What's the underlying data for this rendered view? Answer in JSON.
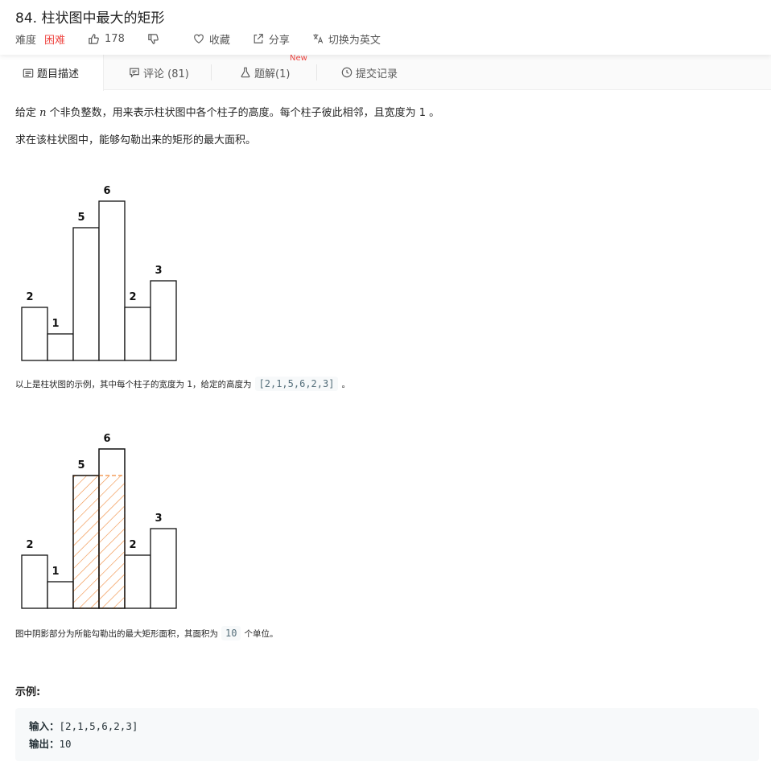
{
  "problem": {
    "title": "84. 柱状图中最大的矩形",
    "difficulty_label": "难度",
    "difficulty": "困难",
    "likes": "178",
    "favorite_label": "收藏",
    "share_label": "分享",
    "switch_label": "切换为英文"
  },
  "tabs": [
    {
      "label": "题目描述"
    },
    {
      "label": "评论 (81)"
    },
    {
      "label": "题解(1)",
      "badge": "New"
    },
    {
      "label": "提交记录"
    }
  ],
  "description": {
    "p1_before": "给定 ",
    "p1_var": "n",
    "p1_after": " 个非负整数，用来表示柱状图中各个柱子的高度。每个柱子彼此相邻，且宽度为 1 。",
    "p2": "求在该柱状图中，能够勾勒出来的矩形的最大面积。",
    "caption1_before": "以上是柱状图的示例，其中每个柱子的宽度为 1，给定的高度为",
    "caption1_code": "[2,1,5,6,2,3]",
    "caption1_after": "。",
    "caption2_before": "图中阴影部分为所能勾勒出的最大矩形面积，其面积为",
    "caption2_code": "10",
    "caption2_after": "个单位。"
  },
  "chart_data": [
    {
      "type": "bar",
      "values": [
        2,
        1,
        5,
        6,
        2,
        3
      ],
      "data_labels": [
        "2",
        "1",
        "5",
        "6",
        "2",
        "3"
      ]
    },
    {
      "type": "bar",
      "values": [
        2,
        1,
        5,
        6,
        2,
        3
      ],
      "data_labels": [
        "2",
        "1",
        "5",
        "6",
        "2",
        "3"
      ],
      "highlight": {
        "bars": [
          2,
          3
        ],
        "height": 5,
        "fill": "hatch",
        "color": "#f08a3c"
      }
    }
  ],
  "example": {
    "label": "示例:",
    "input_label": "输入",
    "input_value": "[2,1,5,6,2,3]",
    "output_label": "输出",
    "output_value": "10"
  },
  "colors": {
    "difficulty": "#ef4743",
    "new_badge": "#ef4743",
    "hatch": "#f08a3c"
  }
}
